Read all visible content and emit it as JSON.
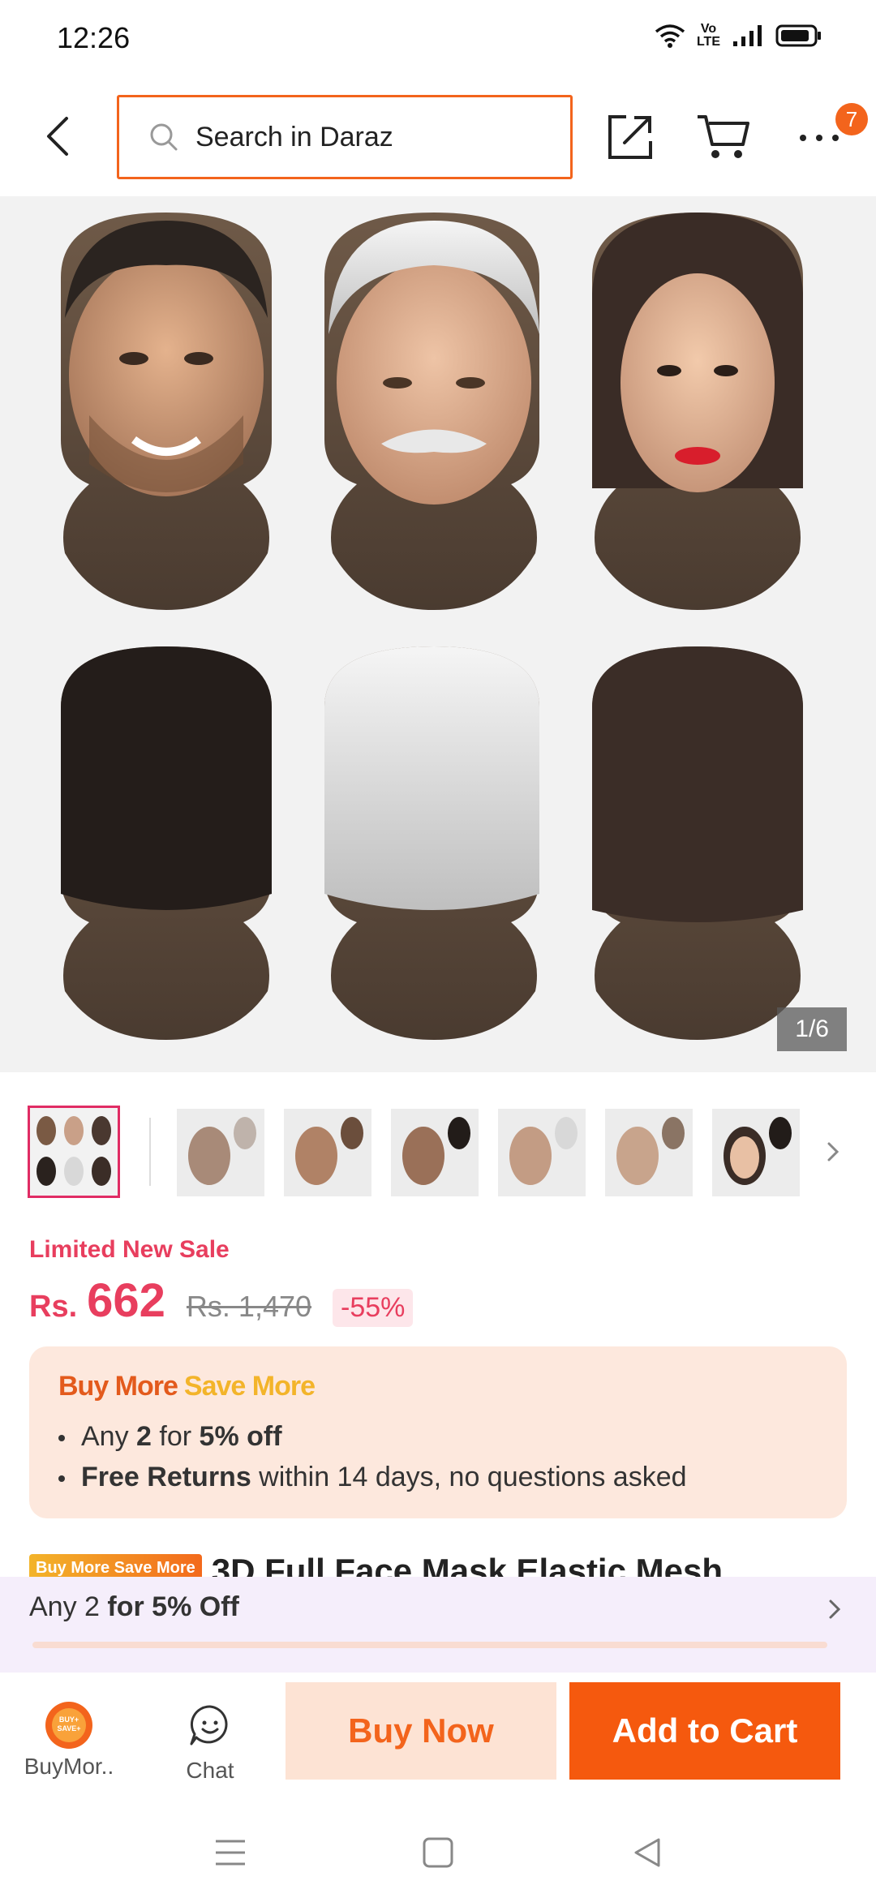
{
  "status_bar": {
    "time": "12:26",
    "lte_label": "Vo\nLTE"
  },
  "header": {
    "search_placeholder": "Search in Daraz",
    "cart_badge": "7"
  },
  "gallery": {
    "counter": "1/6",
    "thumb_count": 7
  },
  "price": {
    "sale_label": "Limited New Sale",
    "currency": "Rs.",
    "value": "662",
    "original": "Rs. 1,470",
    "discount": "-55%"
  },
  "promo": {
    "title_part1": "Buy More",
    "title_part2": "Save More",
    "line1_pre": "Any ",
    "line1_qty": "2",
    "line1_mid": " for ",
    "line1_off": "5% off",
    "line2_bold": "Free Returns",
    "line2_rest": " within 14 days, no questions asked"
  },
  "product": {
    "tag": "Buy More Save More",
    "title": "3D Full Face Mask Elastic Mesh"
  },
  "bundle": {
    "pre": "Any 2 ",
    "bold": "for 5% Off",
    "progress": 0
  },
  "actions": {
    "buymore_label": "BuyMor..",
    "buymore_badge": "BUY+\nSAVE+",
    "chat_label": "Chat",
    "buy_now": "Buy Now",
    "add_to_cart": "Add to Cart"
  },
  "colors": {
    "accent": "#f3641c",
    "price": "#e83e5e",
    "add_to_cart_bg": "#f5590e",
    "buy_now_bg": "#fde3d4"
  }
}
